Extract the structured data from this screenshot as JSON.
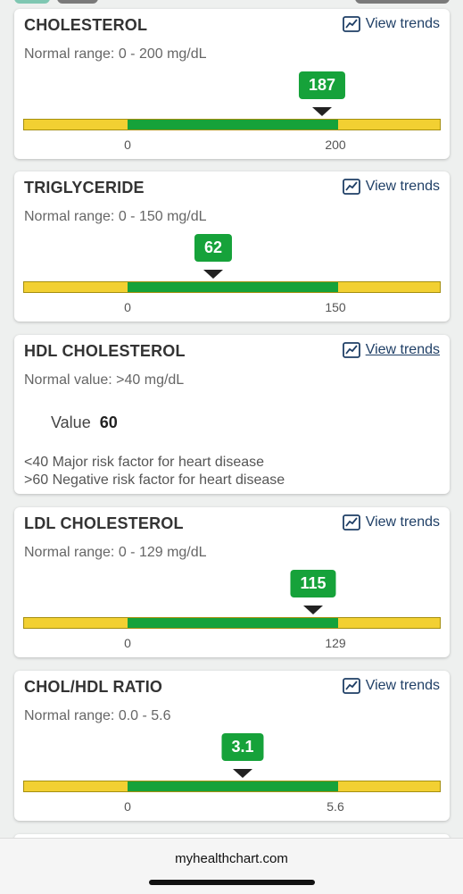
{
  "header": {
    "tab_colors": [
      "#7fc7b2",
      "#7a7a7a",
      "#7a7a7a"
    ]
  },
  "view_trends_label": "View trends",
  "cards": [
    {
      "title": "CHOLESTEROL",
      "range_text": "Normal range: 0 - 200 mg/dL",
      "value": "187",
      "scale_min": "0",
      "scale_max": "200",
      "value_fraction": 0.935
    },
    {
      "title": "TRIGLYCERIDE",
      "range_text": "Normal range: 0 - 150 mg/dL",
      "value": "62",
      "scale_min": "0",
      "scale_max": "150",
      "value_fraction": 0.413
    },
    {
      "title": "HDL CHOLESTEROL",
      "range_text": "Normal value: >40 mg/dL",
      "value_label": "Value",
      "value": "60",
      "notes": [
        "<40 Major risk factor for heart disease",
        ">60 Negative risk factor for heart disease"
      ]
    },
    {
      "title": "LDL CHOLESTEROL",
      "range_text": "Normal range: 0 - 129 mg/dL",
      "value": "115",
      "scale_min": "0",
      "scale_max": "129",
      "value_fraction": 0.891
    },
    {
      "title": "CHOL/HDL RATIO",
      "range_text": "Normal range: 0.0 - 5.6",
      "value": "3.1",
      "scale_min": "0",
      "scale_max": "5.6",
      "value_fraction": 0.554
    }
  ],
  "footer": {
    "url": "myhealthchart.com"
  },
  "colors": {
    "in_range": "#16a23a",
    "out_of_range": "#f2d032",
    "link": "#1f3f66"
  }
}
